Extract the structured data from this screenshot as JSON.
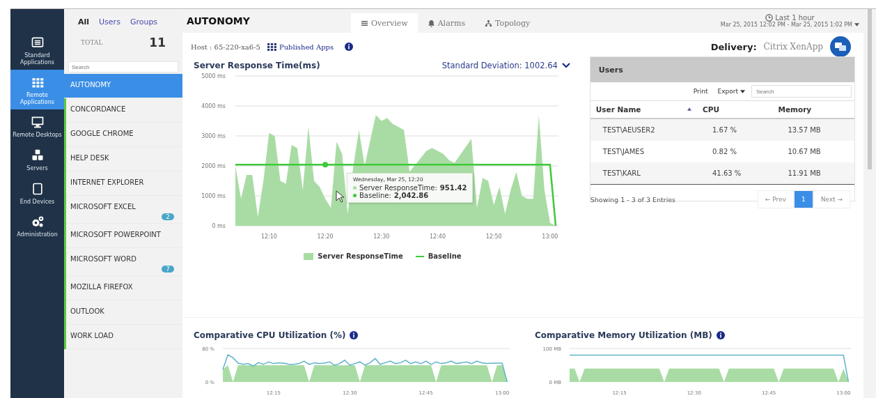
{
  "nav": [
    {
      "label": "Standard Applications",
      "selected": false
    },
    {
      "label": "Remote Applications",
      "selected": true
    },
    {
      "label": "Remote Desktops",
      "selected": false
    },
    {
      "label": "Servers",
      "selected": false
    },
    {
      "label": "End Devices",
      "selected": false
    },
    {
      "label": "Administration",
      "selected": false
    }
  ],
  "filter_tabs": [
    {
      "label": "All",
      "selected": true
    },
    {
      "label": "Users",
      "selected": false
    },
    {
      "label": "Groups",
      "selected": false
    }
  ],
  "total": {
    "label": "TOTAL",
    "value": "11"
  },
  "app_search": {
    "placeholder": "Search"
  },
  "apps": [
    {
      "name": "AUTONOMY",
      "selected": true
    },
    {
      "name": "CONCORDANCE",
      "selected": false
    },
    {
      "name": "GOOGLE CHROME",
      "selected": false
    },
    {
      "name": "HELP DESK",
      "selected": false
    },
    {
      "name": "INTERNET EXPLORER",
      "selected": false
    },
    {
      "name": "MICROSOFT EXCEL",
      "selected": false,
      "badge": "2"
    },
    {
      "name": "MICROSOFT POWERPOINT",
      "selected": false
    },
    {
      "name": "MICROSOFT WORD",
      "selected": false,
      "badge": "7"
    },
    {
      "name": "MOZILLA FIREFOX",
      "selected": false
    },
    {
      "name": "OUTLOOK",
      "selected": false
    },
    {
      "name": "WORK LOAD",
      "selected": false
    }
  ],
  "page": {
    "title": "AUTONOMY",
    "tabs": [
      {
        "label": "Overview",
        "selected": true
      },
      {
        "label": "Alarms",
        "selected": false
      },
      {
        "label": "Topology",
        "selected": false
      }
    ],
    "time": {
      "label": "Last 1 hour",
      "range": "Mar 25, 2015 12:02 PM - Mar 25, 2015 1:02 PM"
    },
    "host": "Host : 65-220-xa6-5",
    "published_link": "Published Apps",
    "delivery": {
      "label": "Delivery:",
      "value": "Citrix XenApp"
    }
  },
  "response_panel": {
    "title": "Server Response Time(ms)",
    "deviation": "Standard Deviation: 1002.64",
    "chart_data": {
      "type": "area",
      "categories": [
        null,
        null,
        null,
        null,
        null,
        null,
        "12:10",
        null,
        null,
        null,
        null,
        null,
        null,
        null,
        null,
        null,
        "12:20",
        null,
        null,
        null,
        null,
        null,
        null,
        null,
        null,
        null,
        "12:30",
        null,
        null,
        null,
        null,
        null,
        null,
        null,
        null,
        null,
        "12:40",
        null,
        null,
        null,
        null,
        null,
        null,
        null,
        null,
        null,
        "12:50",
        null,
        null,
        null,
        null,
        null,
        null,
        null,
        null,
        null,
        "13:00",
        null
      ],
      "series": [
        {
          "name": "Server ResponseTime",
          "type": "area",
          "color": "#a9dca4",
          "values": [
            2000,
            900,
            1700,
            1700,
            300,
            1500,
            3100,
            3000,
            1500,
            1400,
            2700,
            2600,
            1200,
            3300,
            1500,
            1300,
            900,
            600,
            2800,
            2400,
            400,
            2000,
            3200,
            2000,
            null,
            3700,
            3500,
            3600,
            3400,
            3300,
            3200,
            1800,
            null,
            null,
            2500,
            2600,
            2500,
            2400,
            2200,
            2100,
            null,
            null,
            2900,
            600,
            1600,
            1500,
            700,
            1300,
            400,
            1200,
            1800,
            1000,
            900,
            900,
            3700,
            1200,
            100,
            0
          ]
        },
        {
          "name": "Baseline",
          "type": "line",
          "color": "#3ec93a",
          "values": [
            2040,
            2040,
            2040,
            2040,
            2040,
            2040,
            2040,
            2040,
            2040,
            2040,
            2040,
            2040,
            2040,
            2040,
            2040,
            2040,
            2040,
            2040,
            2040,
            2040,
            2040,
            2040,
            2040,
            2040,
            2040,
            2040,
            2040,
            2040,
            2040,
            2040,
            2040,
            2040,
            2040,
            2040,
            2040,
            2040,
            2040,
            2040,
            2040,
            2040,
            2040,
            2040,
            2040,
            2040,
            2040,
            2040,
            2040,
            2040,
            2040,
            2040,
            2040,
            2040,
            2040,
            2040,
            2040,
            2040,
            2040,
            0
          ]
        }
      ],
      "ylim": [
        0,
        5000
      ],
      "grid": true,
      "yticks": [
        {
          "value": 0,
          "label": "0 ms"
        },
        {
          "value": 1000,
          "label": "1000 ms"
        },
        {
          "value": 2000,
          "label": "2000 ms"
        },
        {
          "value": 3000,
          "label": "3000 ms"
        },
        {
          "value": 4000,
          "label": "4000 ms"
        },
        {
          "value": 5000,
          "label": "5000 ms"
        }
      ]
    },
    "tooltip": {
      "title": "Wednesday, Mar 25, 12:20",
      "rows": [
        {
          "label": "Server ResponseTime:",
          "value": "951.42",
          "color": "#a9dca4"
        },
        {
          "label": "Baseline:",
          "value": "2,042.86",
          "color": "#3ec93a"
        }
      ]
    }
  },
  "users": {
    "title": "Users",
    "print": "Print",
    "export": "Export",
    "search": {
      "placeholder": "Search"
    },
    "columns": [
      {
        "label": "User Name",
        "sorted": true
      },
      {
        "label": "CPU",
        "sorted": false
      },
      {
        "label": "Memory",
        "sorted": false
      }
    ],
    "rows": [
      [
        "TEST\\AEUSER2",
        "1.67 %",
        "13.57 MB"
      ],
      [
        "TEST\\JAMES",
        "0.82 %",
        "10.67 MB"
      ],
      [
        "TEST\\KARL",
        "41.63 %",
        "11.91 MB"
      ]
    ],
    "summary": "Showing 1 - 3 of 3 Entries",
    "prev": "← Prev",
    "next": "Next →",
    "pages": [
      {
        "label": "1",
        "selected": true
      }
    ]
  },
  "cpu_panel": {
    "title": "Comparative CPU Utilization (%)",
    "chart_data": {
      "type": "area",
      "categories": [
        null,
        null,
        null,
        null,
        null,
        null,
        null,
        null,
        null,
        null,
        "12:15",
        null,
        null,
        null,
        null,
        null,
        null,
        null,
        null,
        null,
        null,
        null,
        null,
        null,
        null,
        "12:30",
        null,
        null,
        null,
        null,
        null,
        null,
        null,
        null,
        null,
        null,
        null,
        null,
        null,
        null,
        "12:45",
        null,
        null,
        null,
        null,
        null,
        null,
        null,
        null,
        null,
        null,
        null,
        null,
        null,
        null,
        "13:00",
        null
      ],
      "series": [
        {
          "type": "area",
          "color": "#a9dca4",
          "values": [
            30,
            40,
            0,
            40,
            40,
            40,
            40,
            40,
            40,
            40,
            40,
            40,
            40,
            40,
            40,
            40,
            40,
            0,
            40,
            40,
            40,
            40,
            40,
            40,
            40,
            40,
            40,
            0,
            40,
            40,
            40,
            40,
            40,
            40,
            40,
            40,
            40,
            40,
            40,
            40,
            40,
            40,
            0,
            40,
            40,
            40,
            40,
            40,
            40,
            40,
            40,
            40,
            40,
            0,
            40,
            40,
            0
          ]
        },
        {
          "type": "line",
          "color": "#5fb3c9",
          "values": [
            30,
            65,
            58,
            45,
            42,
            44,
            38,
            46,
            42,
            48,
            44,
            46,
            45,
            42,
            42,
            44,
            50,
            42,
            46,
            44,
            45,
            48,
            40,
            44,
            52,
            40,
            44,
            48,
            40,
            46,
            56,
            42,
            46,
            50,
            44,
            46,
            52,
            44,
            48,
            44,
            50,
            42,
            48,
            44,
            46,
            50,
            44,
            46,
            48,
            44,
            50,
            46,
            44,
            45,
            45,
            45,
            0
          ]
        }
      ],
      "ylim": [
        0,
        80
      ],
      "yticks": [
        {
          "value": 0,
          "label": "0 %"
        },
        {
          "value": 80,
          "label": "80 %"
        }
      ]
    }
  },
  "memory_panel": {
    "title": "Comparative Memory Utilization (MB)",
    "chart_data": {
      "type": "area",
      "categories": [
        null,
        null,
        null,
        null,
        null,
        null,
        null,
        null,
        null,
        null,
        "12:15",
        null,
        null,
        null,
        null,
        null,
        null,
        null,
        null,
        null,
        null,
        null,
        null,
        null,
        null,
        "12:30",
        null,
        null,
        null,
        null,
        null,
        null,
        null,
        null,
        null,
        null,
        null,
        null,
        null,
        null,
        "12:45",
        null,
        null,
        null,
        null,
        null,
        null,
        null,
        null,
        null,
        null,
        null,
        null,
        null,
        null,
        "13:00",
        null
      ],
      "series": [
        {
          "type": "area",
          "color": "#a9dca4",
          "values": [
            40,
            40,
            0,
            40,
            40,
            40,
            40,
            40,
            40,
            40,
            40,
            40,
            40,
            40,
            40,
            40,
            40,
            40,
            40,
            0,
            40,
            40,
            40,
            40,
            40,
            40,
            40,
            40,
            40,
            40,
            40,
            0,
            40,
            40,
            40,
            40,
            40,
            40,
            40,
            40,
            40,
            40,
            0,
            40,
            40,
            40,
            40,
            40,
            40,
            40,
            40,
            40,
            40,
            40,
            0,
            40,
            0
          ]
        },
        {
          "type": "line",
          "color": "#5fb3c9",
          "values": [
            80,
            80,
            80,
            80,
            80,
            80,
            80,
            80,
            80,
            80,
            80,
            80,
            80,
            80,
            80,
            80,
            80,
            80,
            80,
            80,
            80,
            80,
            80,
            80,
            80,
            80,
            80,
            80,
            80,
            80,
            80,
            80,
            80,
            80,
            80,
            80,
            80,
            80,
            80,
            80,
            80,
            80,
            80,
            80,
            80,
            80,
            80,
            80,
            80,
            80,
            80,
            80,
            80,
            80,
            80,
            80,
            0
          ]
        }
      ],
      "ylim": [
        0,
        100
      ],
      "yticks": [
        {
          "value": 0,
          "label": "0 MB"
        },
        {
          "value": 100,
          "label": "100 MB"
        }
      ]
    }
  }
}
